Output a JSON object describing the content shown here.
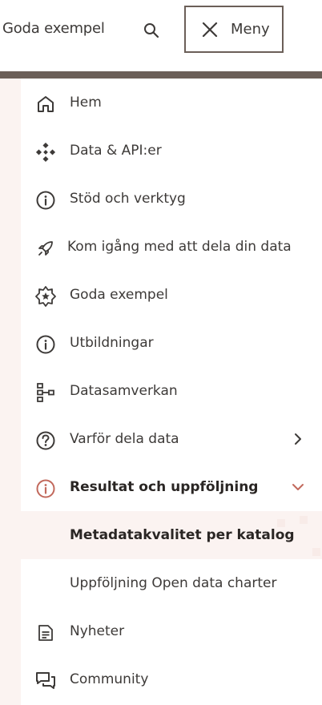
{
  "header": {
    "page_title": "Goda exempel",
    "menu_label": "Meny"
  },
  "nav": {
    "items": [
      {
        "label": "Hem",
        "icon": "home-icon"
      },
      {
        "label": "Data & API:er",
        "icon": "data-icon"
      },
      {
        "label": "Stöd och verktyg",
        "icon": "info-icon"
      },
      {
        "label": "Kom igång med att dela din data",
        "icon": "rocket-icon"
      },
      {
        "label": "Goda exempel",
        "icon": "star-badge-icon"
      },
      {
        "label": "Utbildningar",
        "icon": "info-icon"
      },
      {
        "label": "Datasamverkan",
        "icon": "hierarchy-icon"
      },
      {
        "label": "Varför dela data",
        "icon": "question-icon",
        "chevron": "right"
      },
      {
        "label": "Resultat och uppföljning",
        "icon": "info-icon",
        "chevron": "down",
        "expanded": true
      },
      {
        "label": "Nyheter",
        "icon": "document-icon"
      },
      {
        "label": "Community",
        "icon": "chat-icon"
      }
    ],
    "sub_items": [
      {
        "label": "Metadatakvalitet per katalog",
        "current": true
      },
      {
        "label": "Uppföljning Open data charter"
      }
    ]
  },
  "colors": {
    "text": "#3d3a38",
    "bar": "#6b5f58",
    "accent": "#c2695c",
    "highlight_bg": "#fbf3f1"
  }
}
